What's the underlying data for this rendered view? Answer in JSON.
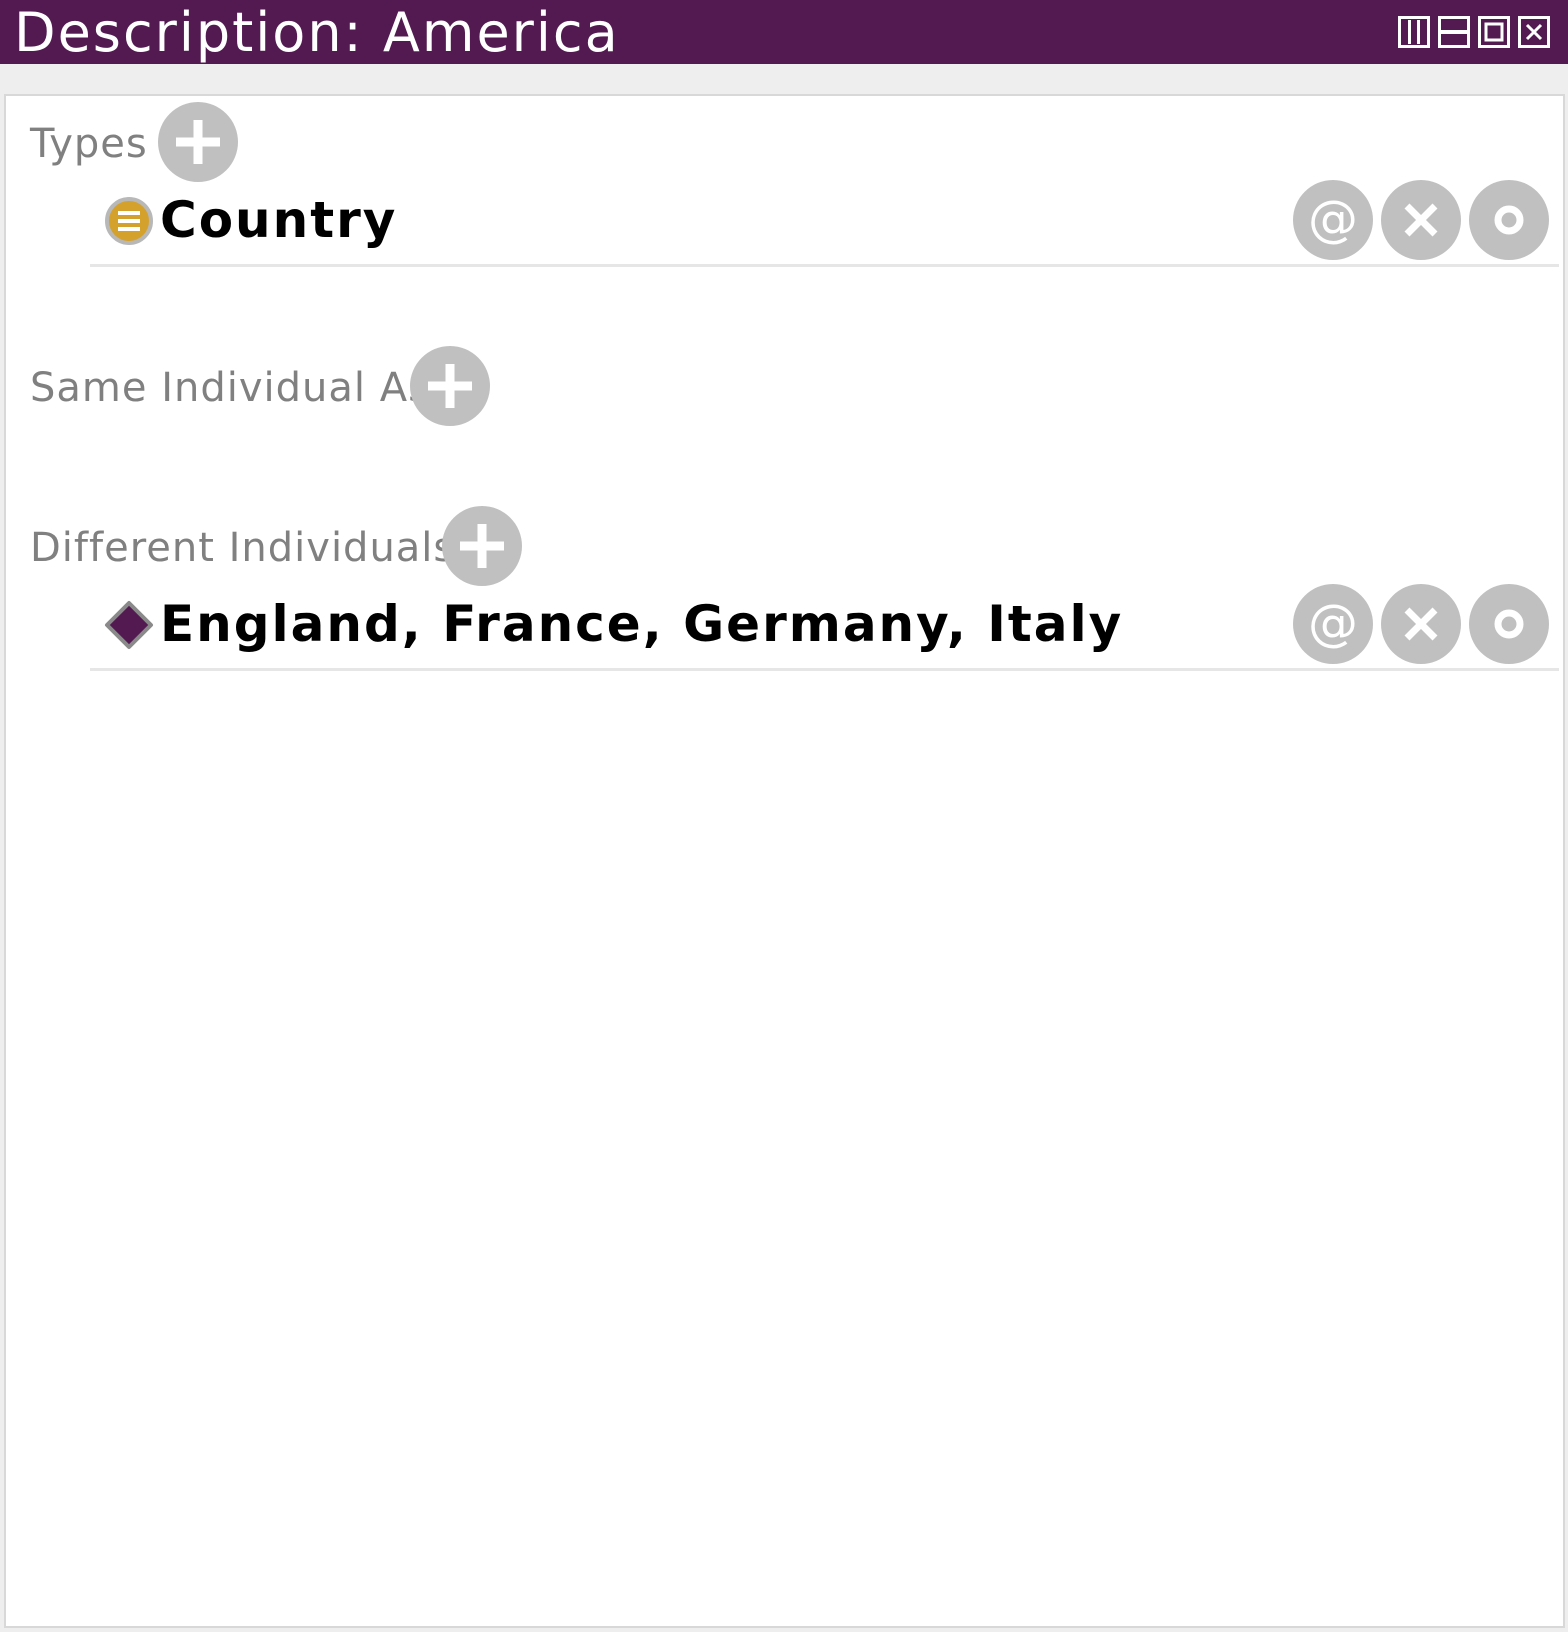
{
  "window": {
    "title": "Description: America",
    "controls": [
      "split-vertical-icon",
      "split-horizontal-icon",
      "maximize-icon",
      "close-icon"
    ],
    "title_bar_color": "#531a51"
  },
  "sections": {
    "types": {
      "label": "Types",
      "items": [
        {
          "text": "Country",
          "icon": "class-icon",
          "icon_color": "#d4a12c"
        }
      ]
    },
    "same_individual_as": {
      "label": "Same Individual As",
      "items": []
    },
    "different_individuals": {
      "label": "Different Individuals",
      "items": [
        {
          "text": "England, France, Germany, Italy",
          "icon": "individual-icon",
          "icon_color": "#531a51"
        }
      ]
    }
  },
  "row_actions": {
    "annotate": "@",
    "delete": "×",
    "explain": "○"
  }
}
